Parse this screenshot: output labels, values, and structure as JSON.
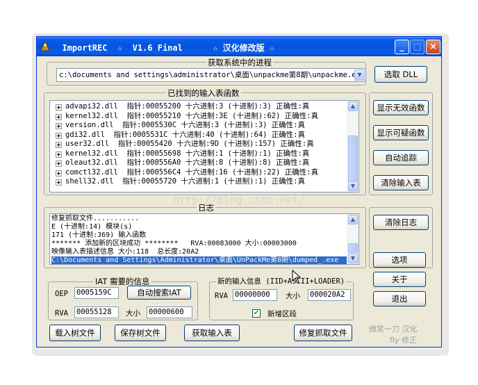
{
  "window": {
    "title": "  ImportREC  ☆  V1.6 Final      ☆ 汉化修改版 ☆",
    "min_icon": "minimize-icon",
    "max_icon": "maximize-icon",
    "close_icon": "close-icon",
    "min_glyph": "_",
    "max_glyph": "□",
    "close_glyph": "×",
    "star": "☆"
  },
  "process": {
    "label": "获取系统中的进程",
    "selected": "c:\\documents and settings\\administrator\\桌面\\unpackme第8期\\unpackme.exe",
    "select_dll_button": "选取 DLL"
  },
  "imports": {
    "label": "已找到的输入表函数",
    "rows": [
      "advapi32.dll  指针:00055200 十六进制:3 (十进制):3) 正确性:真",
      "kernel32.dll  指针:00055210 十六进制:3E (十进制):62) 正确性:真",
      "version.dll  指针:0005530C 十六进制:3 (十进制):3) 正确性:真",
      "gdi32.dll  指针:0005531C 十六进制:40 (十进制):64) 正确性:真",
      "user32.dll  指针:00055420 十六进制:9D (十进制):157) 正确性:真",
      "kernel32.dll  指针:00055698 十六进制:1 (十进制):1) 正确性:真",
      "oleaut32.dll  指针:000556A0 十六进制:8 (十进制):8) 正确性:真",
      "comctl32.dll  指针:000556C4 十六进制:16 (十进制):22) 正确性:真",
      "shell32.dll  指针:00055720 十六进制:1 (十进制):1) 正确性:真"
    ]
  },
  "side_buttons": {
    "show_invalid": "显示无效函数",
    "show_suspect": "显示可疑函数",
    "auto_trace": "自动追踪",
    "clear_imports": "清除输入表",
    "clear_log": "清除日志",
    "options": "选项",
    "about": "关于",
    "exit": "退出"
  },
  "log": {
    "label": "日志",
    "lines": [
      "修复抓取文件...........",
      "E (十进制:14) 模块(s)",
      "171 (十进制:369) 输入函数",
      "******* 添加新的区块成功 ********   RVA:00083000 大小:00003000",
      "映像输入表描述信息 大小:118  总长度:20A2",
      "C:\\Documents and Settings\\Administrator\\桌面\\UnPackMe第8期\\dumped_.exe"
    ]
  },
  "iat": {
    "label": "IAT 需要的信息",
    "oep_label": "OEP",
    "oep_value": "0005159C",
    "auto_search": "自动搜索IAT",
    "rva_label": "RVA",
    "rva_value": "00055128",
    "size_label": "大小",
    "size_value": "00000600"
  },
  "new_import": {
    "label": "新的输入信息 (IID+ASCII+LOADER)",
    "rva_label": "RVA",
    "rva_value": "00000000",
    "size_label": "大小",
    "size_value": "000020A2",
    "add_section_label": "新增区段",
    "add_section_checked": "✔"
  },
  "bottom_buttons": {
    "load_tree": "载入树文件",
    "save_tree": "保存树文件",
    "get_imports": "获取输入表",
    "fix_dump": "修复抓取文件"
  },
  "credits": {
    "line1": "微笑一刀  汉化",
    "line2": "fly  修正"
  },
  "watermark": "http://blog.csdn.net/"
}
